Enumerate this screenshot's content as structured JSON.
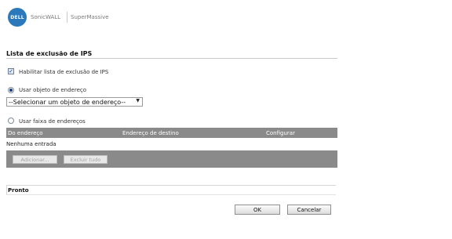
{
  "header": {
    "logo_text": "DELL",
    "product": "SonicWALL",
    "model": "SuperMassive"
  },
  "section": {
    "title": "Lista de exclusão de IPS"
  },
  "enable_checkbox": {
    "label": "Habilitar lista de exclusão de IPS",
    "checked": true
  },
  "address_object": {
    "radio_label": "Usar objeto de endereço",
    "selected": true,
    "select_value": "--Selecionar um objeto de endereço--"
  },
  "address_range": {
    "radio_label": "Usar faixa de endereços",
    "selected": false
  },
  "table": {
    "columns": [
      "Do endereço",
      "Endereço de destino",
      "Configurar"
    ],
    "empty_text": "Nenhuma entrada",
    "add_button": "Adicionar...",
    "clear_button": "Excluir tudo"
  },
  "status": {
    "text": "Pronto"
  },
  "buttons": {
    "ok": "OK",
    "cancel": "Cancelar"
  },
  "colors": {
    "logo_blue": "#2b78ba",
    "table_gray": "#8a8a8a"
  }
}
